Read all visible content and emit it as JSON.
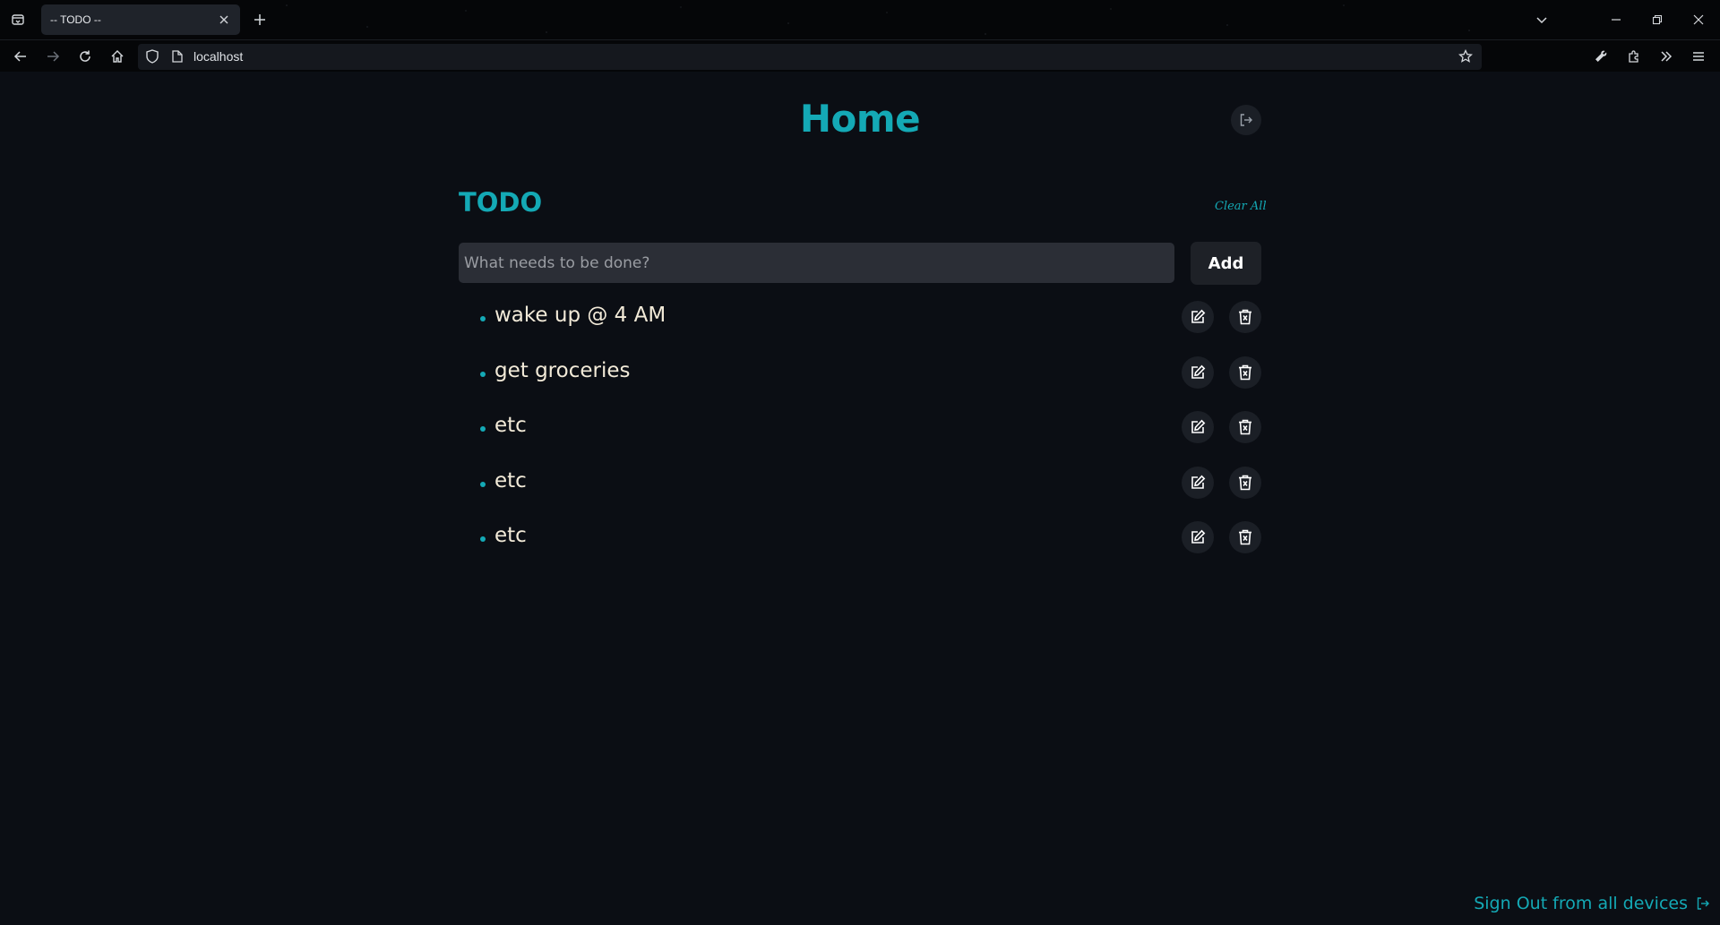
{
  "browser": {
    "tab_title": "-- TODO --",
    "url": "localhost"
  },
  "page": {
    "title": "Home",
    "section_title": "TODO",
    "clear_all_label": "Clear All",
    "input": {
      "placeholder": "What needs to be done?",
      "value": ""
    },
    "add_label": "Add",
    "todos": [
      {
        "text": "wake up @ 4 AM"
      },
      {
        "text": "get groceries"
      },
      {
        "text": "etc"
      },
      {
        "text": "etc"
      },
      {
        "text": "etc"
      }
    ],
    "footer_signout_label": "Sign Out from all devices"
  },
  "colors": {
    "accent": "#14a9b5",
    "background": "#0b0e14",
    "todo_text": "#f2ead8",
    "input_bg": "#2b2e36",
    "button_bg": "#1e2127"
  },
  "icons": {
    "tab_list": "tab-list-icon",
    "new_tab": "plus-icon",
    "list_all_tabs": "chevron-down-icon",
    "minimize": "minimize-icon",
    "restore": "restore-icon",
    "close_window": "close-icon",
    "back": "arrow-left-icon",
    "forward": "arrow-right-icon",
    "reload": "reload-icon",
    "home": "home-icon",
    "tracking_protection": "shield-icon",
    "page_info": "page-icon",
    "bookmark": "star-icon",
    "devtools": "wrench-icon",
    "extensions": "puzzle-icon",
    "overflow": "chevron-double-right-icon",
    "menu": "hamburger-icon",
    "sign_out": "sign-out-icon",
    "edit": "edit-icon",
    "delete": "trash-icon"
  }
}
